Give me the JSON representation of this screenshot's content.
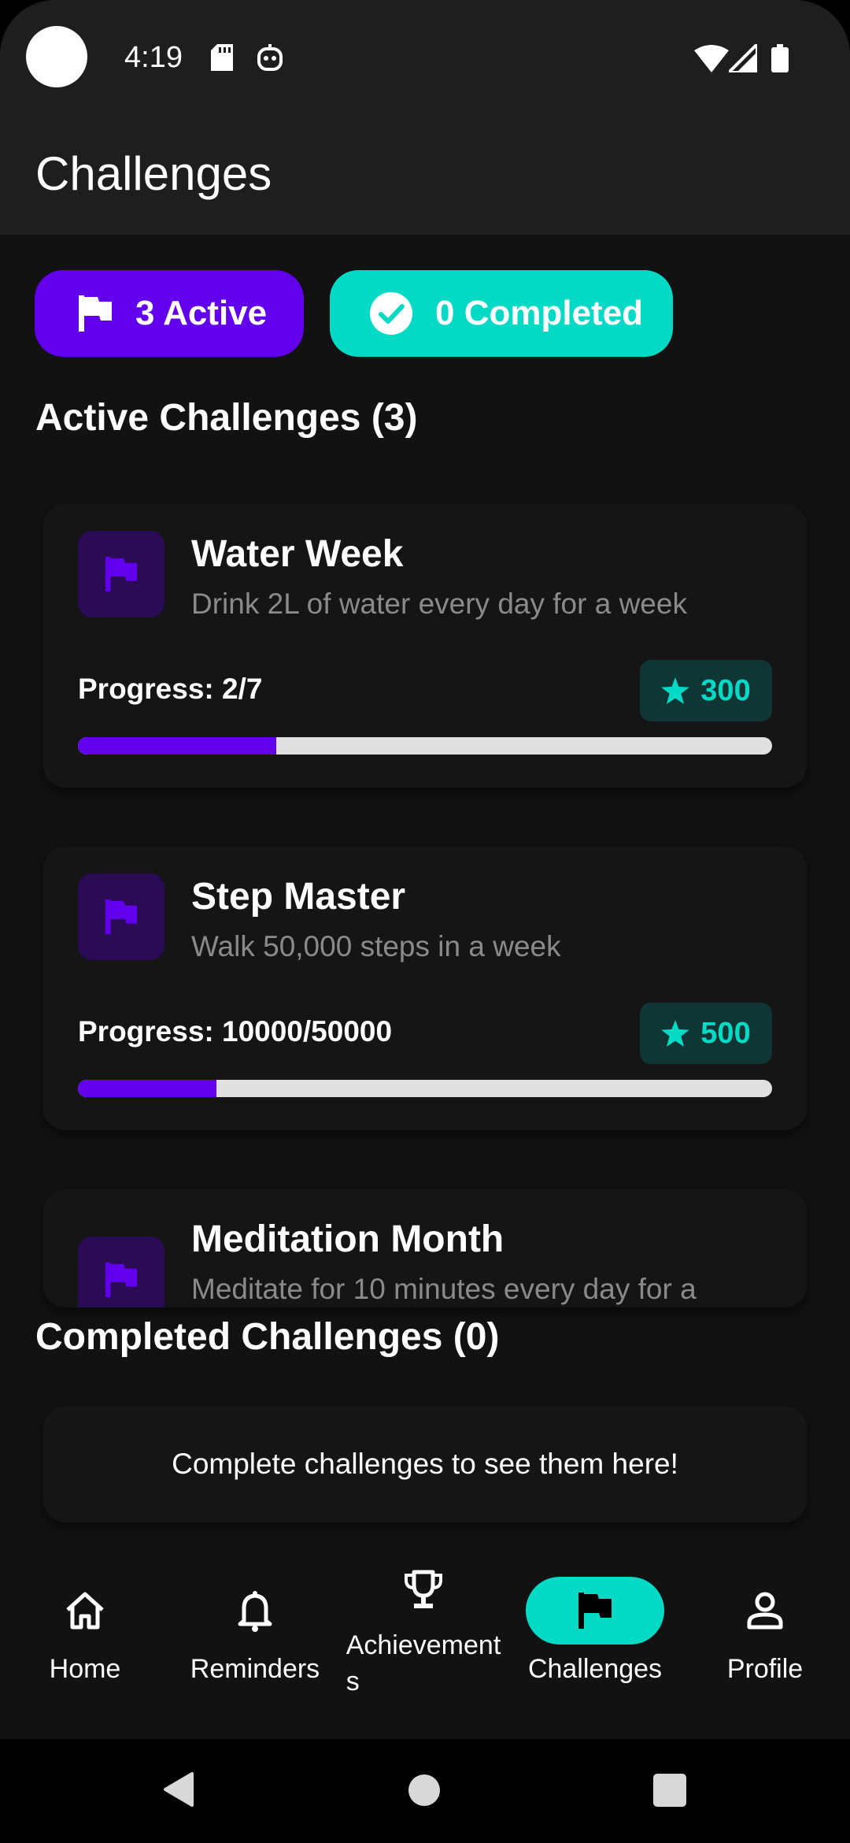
{
  "status_bar": {
    "time": "4:19",
    "icons": [
      "sd-card-icon",
      "robot-icon",
      "wifi-icon",
      "signal-icon",
      "battery-icon"
    ]
  },
  "app_bar": {
    "title": "Challenges"
  },
  "summary": {
    "active_label": "3 Active",
    "completed_label": "0 Completed",
    "active_color": "#6200ee",
    "completed_color": "#03dac6"
  },
  "active_section": {
    "title": "Active Challenges (3)"
  },
  "challenges": [
    {
      "title": "Water Week",
      "description": "Drink 2L of water every day for a week",
      "progress_label": "Progress: 2/7",
      "points": "300",
      "progress_fraction": 0.2857
    },
    {
      "title": "Step Master",
      "description": "Walk 50,000 steps in a week",
      "progress_label": "Progress: 10000/50000",
      "points": "500",
      "progress_fraction": 0.2
    },
    {
      "title": "Meditation Month",
      "description": "Meditate for 10 minutes every day for a"
    }
  ],
  "completed_section": {
    "title": "Completed Challenges (0)",
    "empty_message": "Complete challenges to see them here!"
  },
  "bottom_nav": {
    "items": [
      {
        "label": "Home",
        "icon": "home-icon"
      },
      {
        "label": "Reminders",
        "icon": "bell-icon"
      },
      {
        "label": "Achievement\ns",
        "icon": "trophy-icon"
      },
      {
        "label": "Challenges",
        "icon": "flag-icon",
        "active": true
      },
      {
        "label": "Profile",
        "icon": "person-icon"
      }
    ],
    "active_color": "#03dac6"
  },
  "system_nav": {
    "icons": [
      "back-icon",
      "home-circle-icon",
      "recents-icon"
    ]
  }
}
